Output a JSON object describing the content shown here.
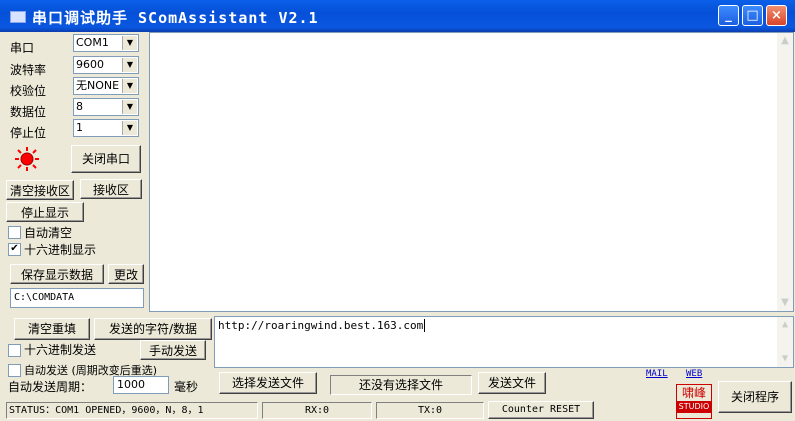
{
  "window": {
    "title": "串口调试助手 SComAssistant V2.1"
  },
  "settings": {
    "port_label": "串口",
    "port_value": "COM1",
    "baud_label": "波特率",
    "baud_value": "9600",
    "parity_label": "校验位",
    "parity_value": "无NONE",
    "databits_label": "数据位",
    "databits_value": "8",
    "stopbits_label": "停止位",
    "stopbits_value": "1"
  },
  "indicator_color": "#ff0000",
  "buttons": {
    "close_port": "关闭串口",
    "clear_recv": "清空接收区",
    "recv_area": "接收区",
    "stop_display": "停止显示",
    "save_display": "保存显示数据",
    "change": "更改",
    "clear_resend": "清空重填",
    "send_chars": "发送的字符/数据",
    "manual_send": "手动发送",
    "choose_file": "选择发送文件",
    "send_file": "发送文件",
    "close_program": "关闭程序"
  },
  "checkboxes": {
    "auto_clear": "自动清空",
    "hex_display": "十六进制显示",
    "hex_send": "十六进制发送",
    "auto_send": "自动发送 (周期改变后重选)"
  },
  "save_path": "C:\\COMDATA",
  "send_text": "http://roaringwind.best.163.com",
  "auto_period": {
    "label": "自动发送周期：",
    "value": "1000",
    "unit": "毫秒"
  },
  "file_status": "还没有选择文件",
  "links": {
    "mail": "MAIL",
    "web": "WEB"
  },
  "logo": {
    "line1": "啸峰",
    "line2": "STUDIO"
  },
  "status": {
    "main": "STATUS：COM1 OPENED，9600，N，8，1",
    "rx": "RX:0",
    "tx": "TX:0",
    "counter_reset": "Counter RESET"
  }
}
